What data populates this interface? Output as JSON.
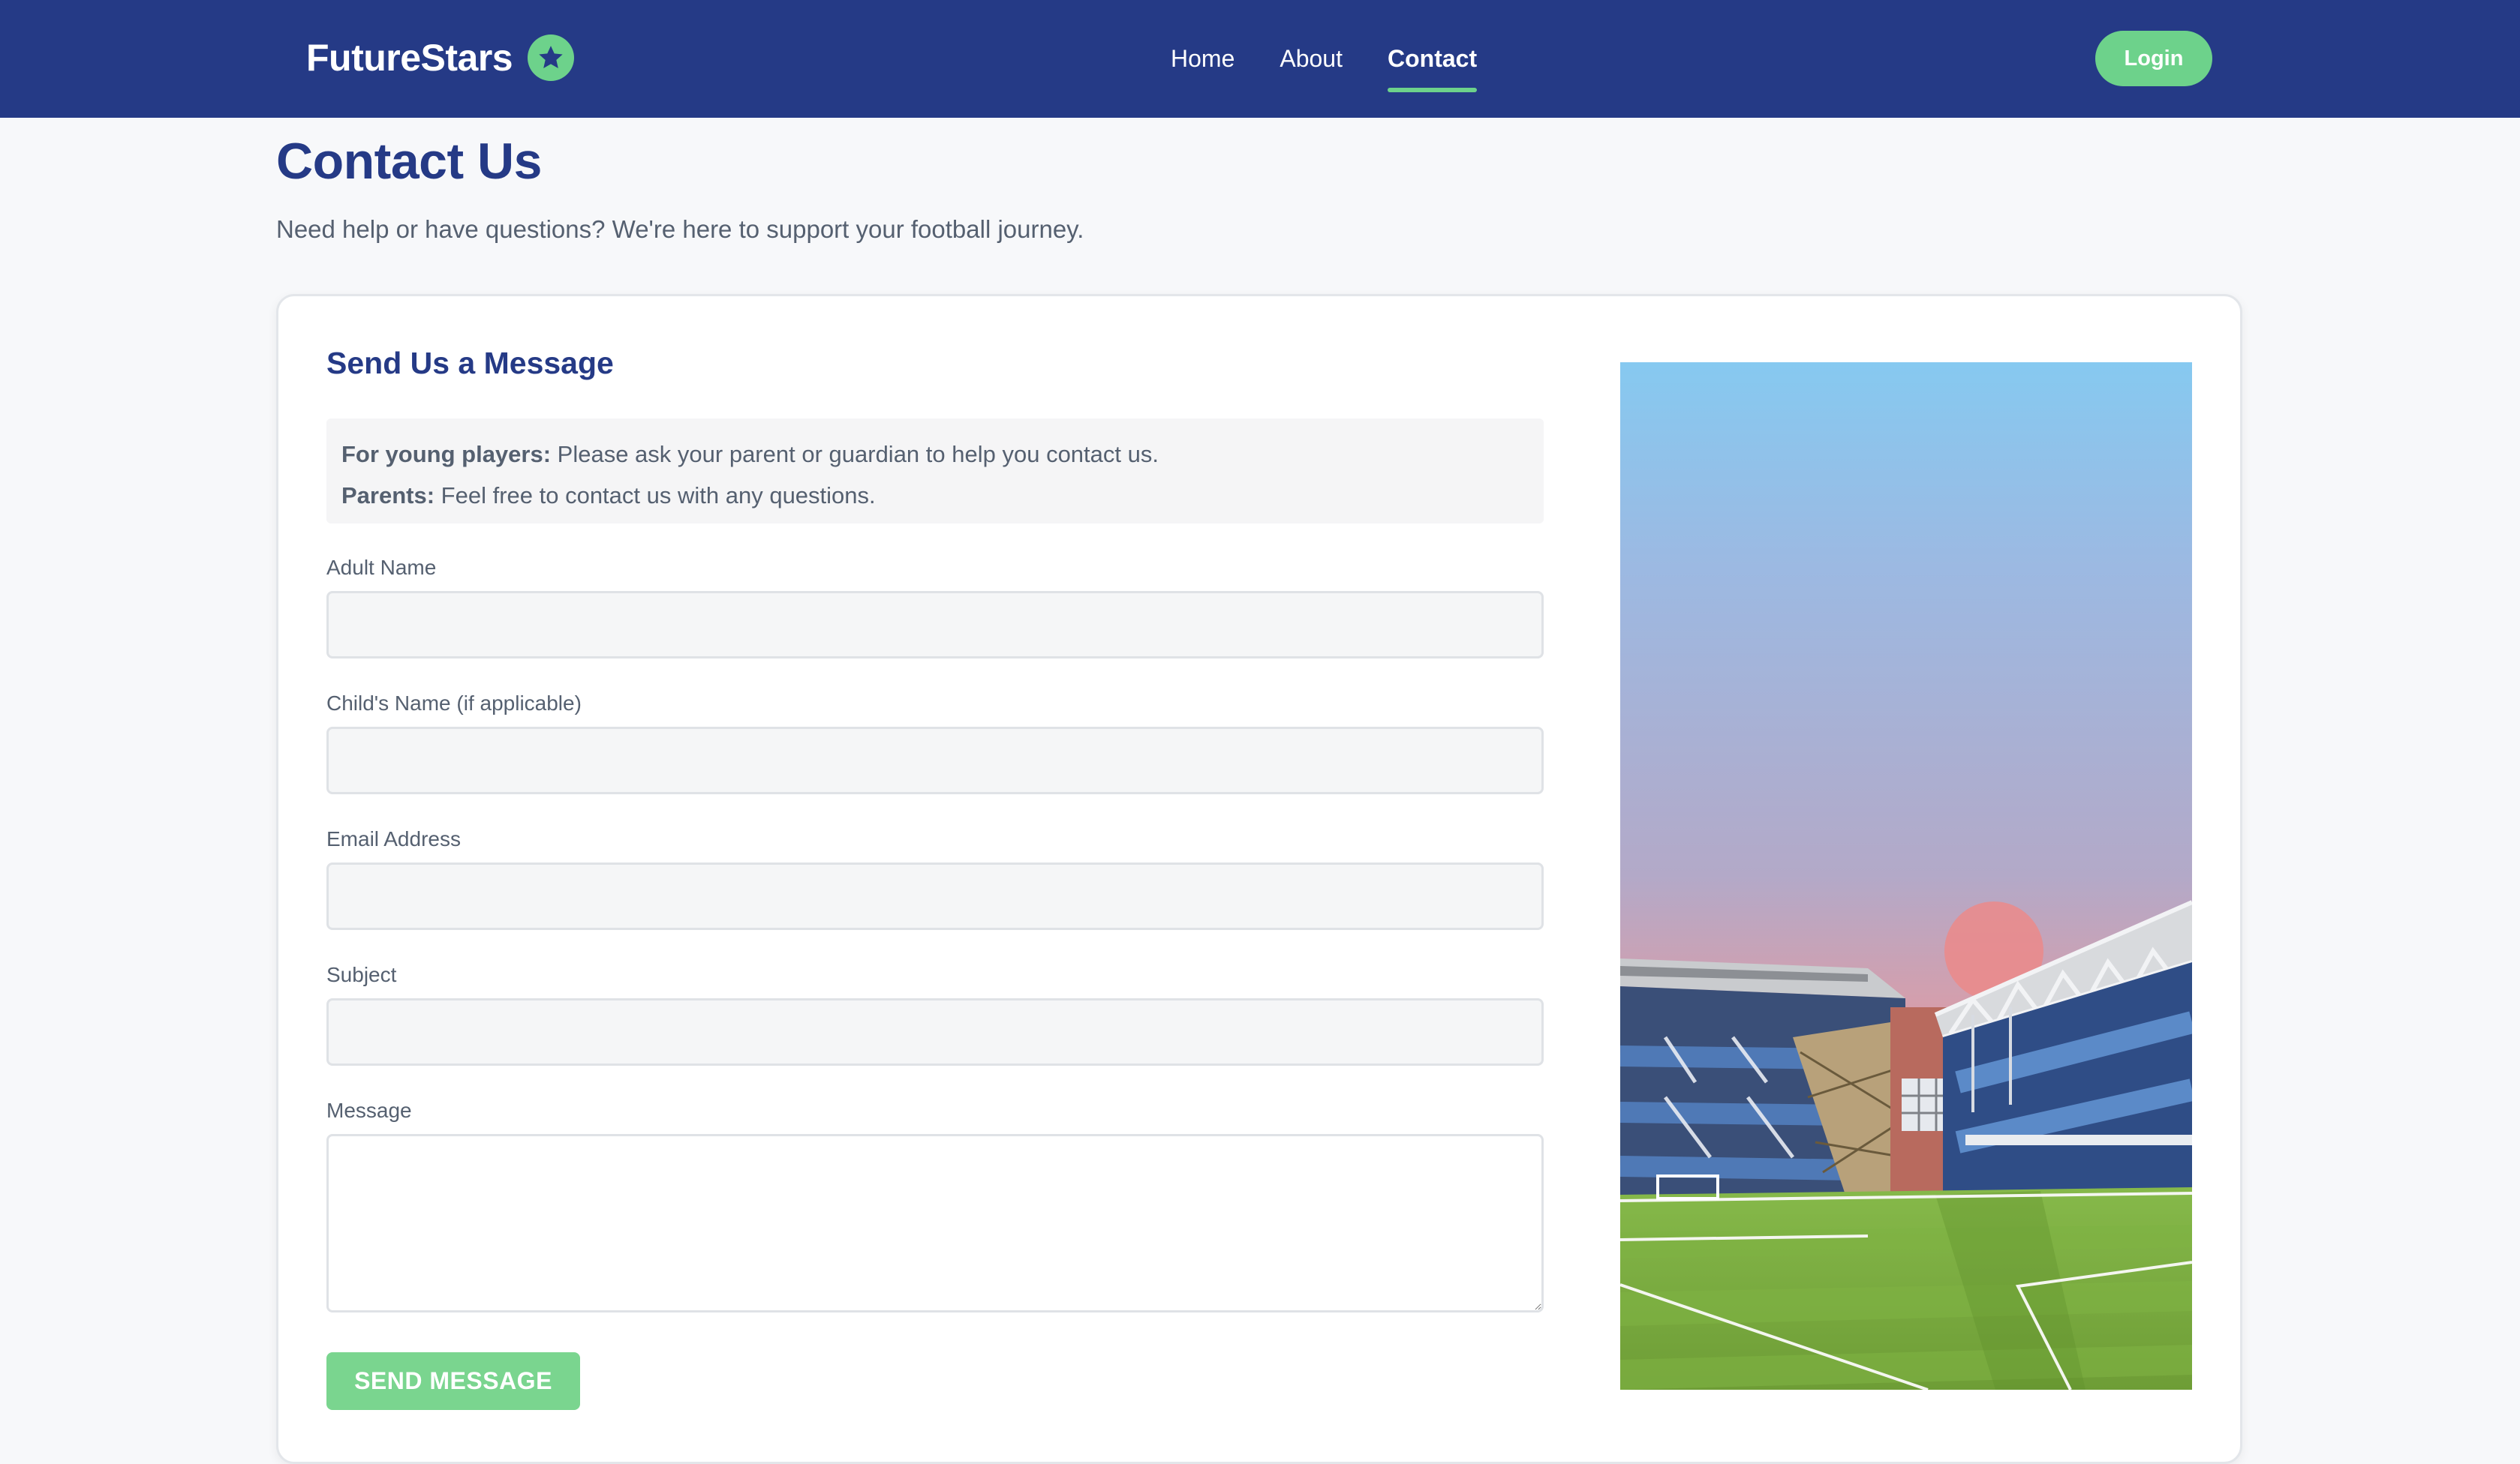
{
  "header": {
    "brand_name": "FutureStars",
    "brand_icon": "star-icon",
    "nav": [
      {
        "label": "Home",
        "active": false
      },
      {
        "label": "About",
        "active": false
      },
      {
        "label": "Contact",
        "active": true
      }
    ],
    "login_label": "Login"
  },
  "page": {
    "title": "Contact Us",
    "subtitle": "Need help or have questions? We're here to support your football journey."
  },
  "form": {
    "title": "Send Us a Message",
    "note": {
      "young_label": "For young players:",
      "young_text": " Please ask your parent or guardian to help you contact us.",
      "parents_label": "Parents:",
      "parents_text": " Feel free to contact us with any questions."
    },
    "fields": {
      "adult_name": {
        "label": "Adult Name",
        "value": ""
      },
      "child_name": {
        "label": "Child's Name (if applicable)",
        "value": ""
      },
      "email": {
        "label": "Email Address",
        "value": ""
      },
      "subject": {
        "label": "Subject",
        "value": ""
      },
      "message": {
        "label": "Message",
        "value": ""
      }
    },
    "submit_label": "SEND MESSAGE"
  },
  "colors": {
    "navbar": "#253a86",
    "accent_green": "#6dd28b",
    "heading_blue": "#253a86"
  }
}
